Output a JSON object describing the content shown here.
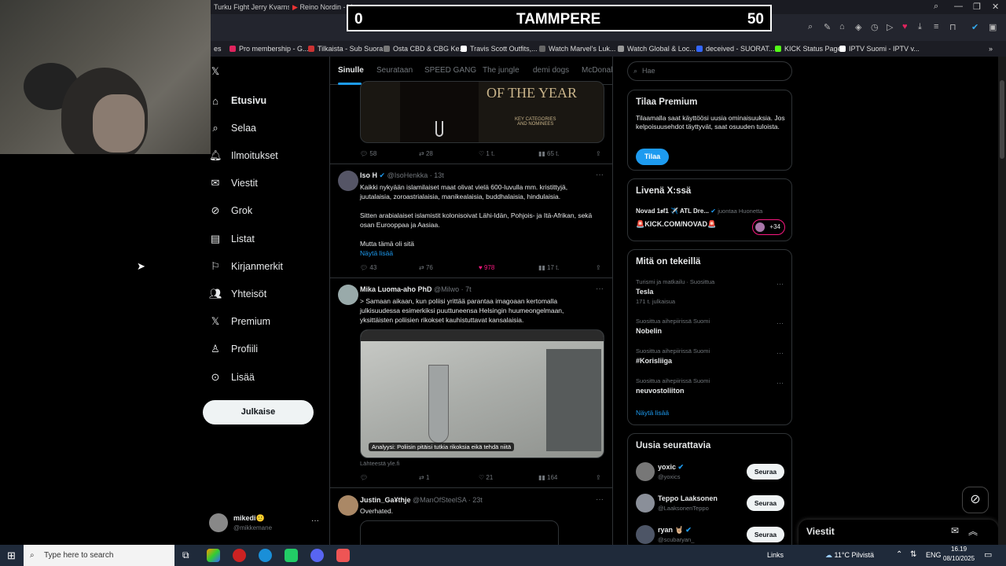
{
  "browser": {
    "tabs": [
      "Turku Fight Jerry Kvarnstr...",
      "Reino Nordin - Vesenmi..."
    ],
    "bookmarks": [
      "Pro membership - G...",
      "Tilkaista - Sub Suora",
      "Osta CBD & CBG Ke...",
      "Travis Scott Outfits,...",
      "Watch Marvel's Luk...",
      "Watch Global & Loc...",
      "deceived - SUORAT...",
      "KICK Status Page",
      "IPTV Suomi - IPTV v..."
    ]
  },
  "score": {
    "left": "0",
    "title": "TAMMPERE",
    "right": "50"
  },
  "nav": {
    "items": [
      "Etusivu",
      "Selaa",
      "Ilmoitukset",
      "Viestit",
      "Grok",
      "Listat",
      "Kirjanmerkit",
      "Yhteisöt",
      "Premium",
      "Profiili",
      "Lisää"
    ],
    "post_label": "Julkaise",
    "user_name": "mikedi🙂",
    "user_handle": "@mikkemane",
    "user_more": "···"
  },
  "feed": {
    "tabs": [
      "Sinulle",
      "Seurataan",
      "SPEED GANG",
      "The jungle",
      "demi dogs",
      "McDonal"
    ],
    "top_card": {
      "banner_text": "OF THE YEAR",
      "banner_sub": "KEY CATEGORIES\nAND NOMINEES",
      "replies": "58",
      "reposts": "28",
      "likes": "1 t.",
      "views": "65 t."
    },
    "tweet1": {
      "name": "Iso H",
      "handle": "@IsoHenkka · 13t",
      "text1": "Kaikki nykyään islamilaiset maat olivat vielä 600-luvulla mm. kristittyjä, juutalaisia, zoroastrialaisia, manikealaisia, buddhalaisia, hindulaisia.",
      "text2": "Sitten arabialaiset islamistit kolonisoivat Lähi-Idän, Pohjois- ja Itä-Afrikan, sekä osan Eurooppaa ja Aasiaa.",
      "text3": "Mutta tämä oli sitä",
      "show_more": "Näytä lisää",
      "replies": "43",
      "reposts": "76",
      "likes": "978",
      "views": "17 t."
    },
    "tweet2": {
      "name": "Mika Luoma-aho PhD",
      "handle": "@Milwo · 7t",
      "text": "> Samaan aikaan, kun poliisi yrittää parantaa imagoaan kertomalla julkisuudessa esimerkiksi puuttuneensa Helsingin huumeongelmaan, yksittäisten poliisien rikokset kauhistuttavat kansalaisia.",
      "caption": "Analyysi: Poliisin pitäisi tutkia rikoksia eikä tehdä niitä",
      "source": "Lähteestä yle.fi",
      "replies": "",
      "reposts": "1",
      "likes": "21",
      "views": "164"
    },
    "tweet3": {
      "name": "Justin_Ga¥thje",
      "handle": "@ManOfSteelSA · 23t",
      "text": "Overhated."
    }
  },
  "right": {
    "search_placeholder": "Hae",
    "premium": {
      "title": "Tilaa Premium",
      "text": "Tilaamalla saat käyttöösi uusia ominaisuuksia. Jos kelpoisuusehdot täyttyvät, saat osuuden tuloista.",
      "button": "Tilaa"
    },
    "live": {
      "title": "Livenä X:ssä",
      "host": "Novad 1𝖔f1 ✈️ ATL Dre...",
      "host_suffix": "juontaa Huonetta",
      "link": "🚨KICK.COM/NOVAD🚨",
      "count": "+34"
    },
    "trends": {
      "title": "Mitä on tekeillä",
      "items": [
        {
          "meta": "Turismi ja matkailu · Suosittua",
          "name": "Tesla",
          "count": "171 t. julkaisua"
        },
        {
          "meta": "Suosittua aihepiirissä Suomi",
          "name": "Nobelin",
          "count": ""
        },
        {
          "meta": "Suosittua aihepiirissä Suomi",
          "name": "#Korisliiga",
          "count": ""
        },
        {
          "meta": "Suosittua aihepiirissä Suomi",
          "name": "neuvostoliiton",
          "count": ""
        }
      ],
      "show_more": "Näytä lisää"
    },
    "follow": {
      "title": "Uusia seurattavia",
      "button": "Seuraa",
      "users": [
        {
          "name": "yoxic",
          "handle": "@yoxics"
        },
        {
          "name": "Teppo Laaksonen",
          "handle": "@LaaksonenTeppo"
        },
        {
          "name": "ryan 🤘🏼",
          "handle": "@scubaryan_"
        }
      ]
    },
    "messages_label": "Viestit"
  },
  "taskbar": {
    "search_placeholder": "Type here to search",
    "links": "Links",
    "weather": "11°C  Pilvistä",
    "lang": "ENG",
    "time": "16.19",
    "date": "08/10/2025"
  }
}
